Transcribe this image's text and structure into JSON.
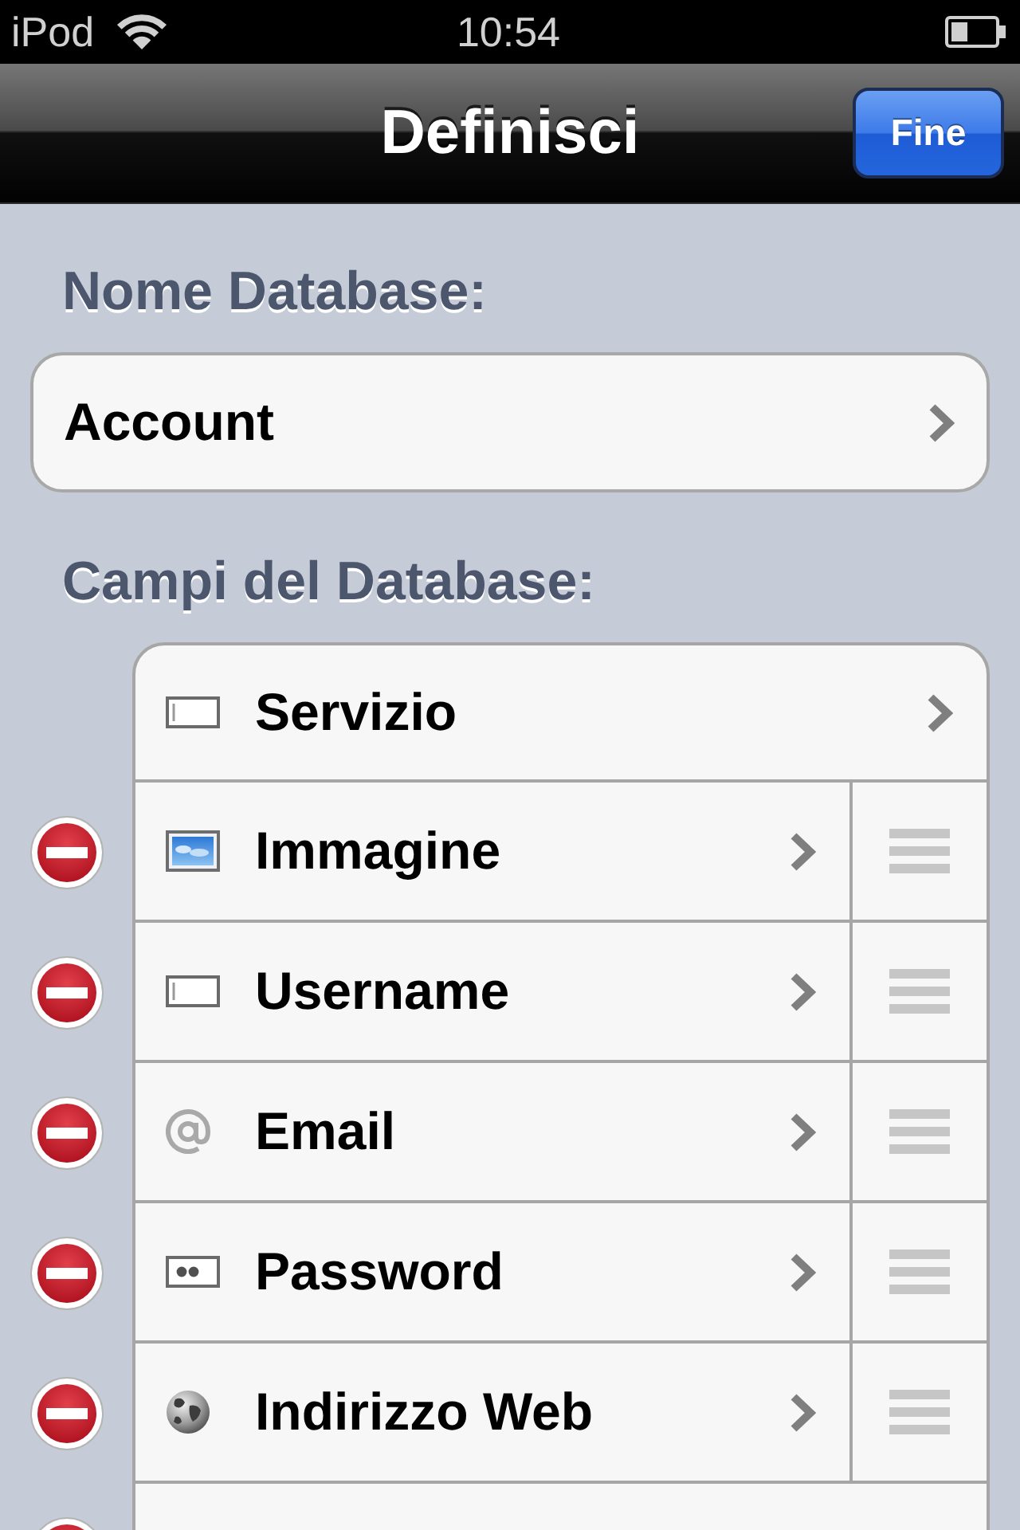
{
  "status_bar": {
    "carrier": "iPod",
    "time": "10:54"
  },
  "nav_bar": {
    "title": "Definisci",
    "done_button": "Fine"
  },
  "database_name": {
    "header": "Nome Database:",
    "value": "Account"
  },
  "fields_section": {
    "header": "Campi del Database:",
    "fields": [
      {
        "label": "Servizio",
        "kind": "text",
        "deletable": false,
        "reorderable": false
      },
      {
        "label": "Immagine",
        "kind": "image",
        "deletable": true,
        "reorderable": true
      },
      {
        "label": "Username",
        "kind": "text",
        "deletable": true,
        "reorderable": true
      },
      {
        "label": "Email",
        "kind": "email",
        "deletable": true,
        "reorderable": true
      },
      {
        "label": "Password",
        "kind": "password",
        "deletable": true,
        "reorderable": true
      },
      {
        "label": "Indirizzo Web",
        "kind": "web",
        "deletable": true,
        "reorderable": true
      },
      {
        "kind": "blank",
        "deletable": true,
        "reorderable": false
      }
    ]
  }
}
